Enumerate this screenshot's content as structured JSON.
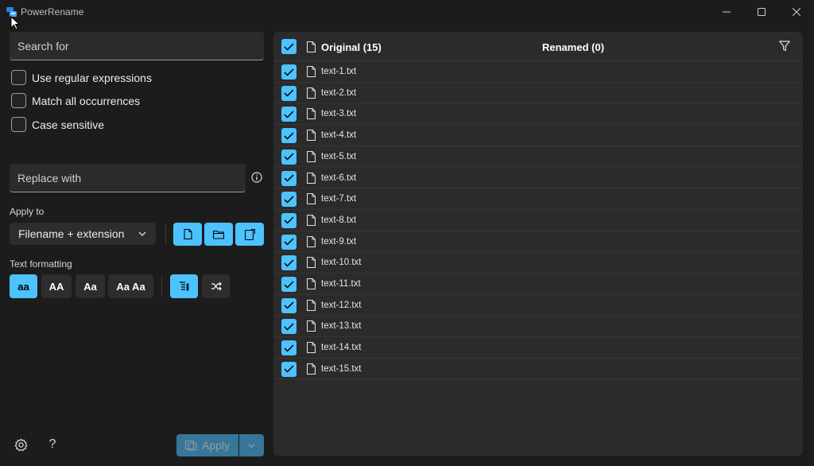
{
  "window": {
    "title": "PowerRename"
  },
  "search": {
    "placeholder": "Search for"
  },
  "options": [
    {
      "label": "Use regular expressions",
      "checked": false
    },
    {
      "label": "Match all occurrences",
      "checked": false
    },
    {
      "label": "Case sensitive",
      "checked": false
    }
  ],
  "replace": {
    "placeholder": "Replace with"
  },
  "apply_to": {
    "label": "Apply to",
    "selected": "Filename + extension"
  },
  "text_formatting": {
    "label": "Text formatting",
    "buttons": [
      "aa",
      "AA",
      "Aa",
      "Aa Aa"
    ]
  },
  "list": {
    "header_original": "Original (15)",
    "header_renamed": "Renamed (0)",
    "files": [
      "text-1.txt",
      "text-2.txt",
      "text-3.txt",
      "text-4.txt",
      "text-5.txt",
      "text-6.txt",
      "text-7.txt",
      "text-8.txt",
      "text-9.txt",
      "text-10.txt",
      "text-11.txt",
      "text-12.txt",
      "text-13.txt",
      "text-14.txt",
      "text-15.txt"
    ]
  },
  "footer": {
    "apply_label": "Apply",
    "help_label": "?"
  },
  "colors": {
    "accent": "#4cc2ff",
    "background": "#1c1c1c",
    "panel": "#2b2b2b"
  }
}
